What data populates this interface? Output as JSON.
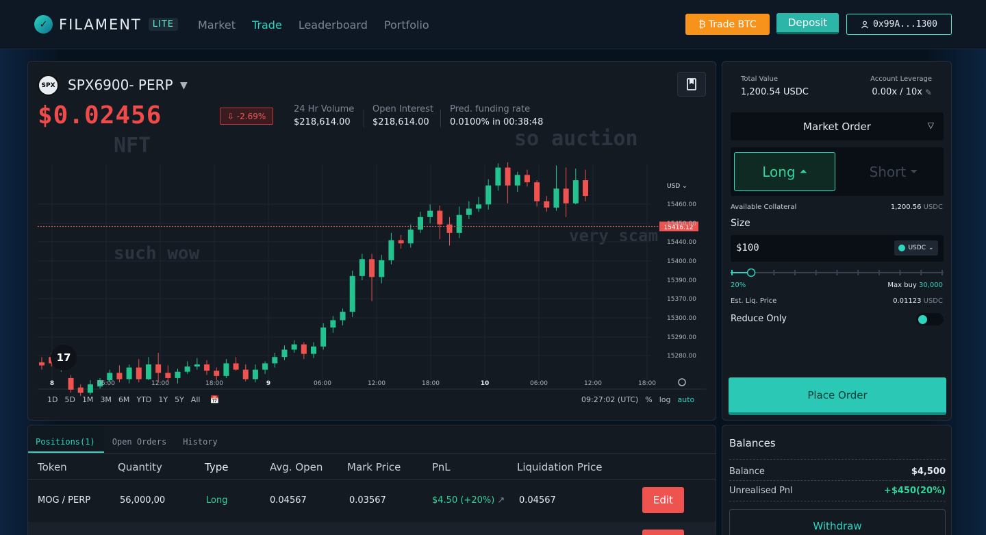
{
  "app": {
    "brand": "FILAMENT",
    "edition": "LITE"
  },
  "nav": [
    {
      "label": "Market",
      "active": false
    },
    {
      "label": "Trade",
      "active": true
    },
    {
      "label": "Leaderboard",
      "active": false
    },
    {
      "label": "Portfolio",
      "active": false
    }
  ],
  "header": {
    "trade_btc": "Trade BTC",
    "deposit": "Deposit",
    "wallet": "0x99A...1300"
  },
  "market": {
    "name": "SPX6900- PERP",
    "price": "$0.02456",
    "change": "-2.69%",
    "stats": [
      {
        "label": "24 Hr Volume",
        "value": "$218,614.00"
      },
      {
        "label": "Open Interest",
        "value": "$218,614.00"
      },
      {
        "label": "Pred. funding rate",
        "value": "0.0100% in 00:38:48"
      }
    ],
    "watermarks": [
      "NFT",
      "so auction",
      "such wow",
      "very scam"
    ]
  },
  "chart_data": {
    "type": "candlestick",
    "currency": "USD",
    "ylim": [
      15270,
      15475
    ],
    "y_ticks": [
      "15460.00",
      "15450.00",
      "15440.00",
      "15400.00",
      "15390.00",
      "15370.00",
      "15300.00",
      "15290.00",
      "15280.00"
    ],
    "x_ticks": [
      "8",
      "06:00",
      "12:00",
      "18:00",
      "9",
      "06:00",
      "12:00",
      "18:00",
      "10",
      "06:00",
      "12:00",
      "18:00"
    ],
    "last_price": "15416.12",
    "candles": [
      [
        15287,
        15284,
        15292,
        15280
      ],
      [
        15292,
        15286,
        15296,
        15283
      ],
      [
        15280,
        15287,
        15290,
        15278
      ],
      [
        15272,
        15261,
        15275,
        15258
      ],
      [
        15263,
        15258,
        15266,
        15255
      ],
      [
        15258,
        15266,
        15270,
        15256
      ],
      [
        15264,
        15270,
        15272,
        15262
      ],
      [
        15270,
        15277,
        15280,
        15268
      ],
      [
        15277,
        15271,
        15284,
        15268
      ],
      [
        15271,
        15282,
        15285,
        15267
      ],
      [
        15282,
        15271,
        15290,
        15268
      ],
      [
        15271,
        15285,
        15292,
        15270
      ],
      [
        15285,
        15277,
        15296,
        15268
      ],
      [
        15277,
        15272,
        15284,
        15268
      ],
      [
        15272,
        15278,
        15281,
        15267
      ],
      [
        15278,
        15283,
        15288,
        15276
      ],
      [
        15283,
        15285,
        15291,
        15280
      ],
      [
        15285,
        15279,
        15289,
        15275
      ],
      [
        15279,
        15274,
        15282,
        15270
      ],
      [
        15274,
        15286,
        15290,
        15272
      ],
      [
        15286,
        15280,
        15292,
        15279
      ],
      [
        15280,
        15271,
        15285,
        15269
      ],
      [
        15271,
        15280,
        15285,
        15268
      ],
      [
        15280,
        15286,
        15288,
        15276
      ],
      [
        15286,
        15292,
        15296,
        15282
      ],
      [
        15292,
        15299,
        15303,
        15289
      ],
      [
        15299,
        15304,
        15308,
        15296
      ],
      [
        15304,
        15295,
        15306,
        15290
      ],
      [
        15295,
        15302,
        15306,
        15291
      ],
      [
        15302,
        15320,
        15324,
        15299
      ],
      [
        15320,
        15327,
        15331,
        15315
      ],
      [
        15327,
        15335,
        15338,
        15322
      ],
      [
        15335,
        15369,
        15374,
        15330
      ],
      [
        15369,
        15385,
        15390,
        15365
      ],
      [
        15385,
        15368,
        15390,
        15345
      ],
      [
        15368,
        15384,
        15389,
        15362
      ],
      [
        15384,
        15403,
        15410,
        15380
      ],
      [
        15403,
        15400,
        15408,
        15395
      ],
      [
        15400,
        15413,
        15418,
        15396
      ],
      [
        15413,
        15425,
        15430,
        15410
      ],
      [
        15425,
        15431,
        15437,
        15419
      ],
      [
        15431,
        15418,
        15436,
        15404
      ],
      [
        15418,
        15410,
        15425,
        15398
      ],
      [
        15410,
        15427,
        15435,
        15405
      ],
      [
        15427,
        15433,
        15440,
        15423
      ],
      [
        15433,
        15437,
        15444,
        15430
      ],
      [
        15437,
        15455,
        15461,
        15432
      ],
      [
        15455,
        15472,
        15476,
        15450
      ],
      [
        15472,
        15455,
        15477,
        15438
      ],
      [
        15455,
        15465,
        15468,
        15449
      ],
      [
        15465,
        15458,
        15470,
        15454
      ],
      [
        15458,
        15440,
        15460,
        15435
      ],
      [
        15440,
        15434,
        15445,
        15430
      ],
      [
        15434,
        15452,
        15474,
        15431
      ],
      [
        15452,
        15438,
        15472,
        15425
      ],
      [
        15438,
        15460,
        15471,
        15437
      ],
      [
        15460,
        15445,
        15470,
        15440
      ]
    ]
  },
  "timeframes": [
    "1D",
    "5D",
    "1M",
    "3M",
    "6M",
    "YTD",
    "1Y",
    "5Y",
    "All"
  ],
  "chart_footer": {
    "time": "09:27:02 (UTC)",
    "pct": "%",
    "log": "log",
    "auto": "auto"
  },
  "order": {
    "total_value_label": "Total Value",
    "total_value": "1,200.54 USDC",
    "leverage_label": "Account Leverage",
    "leverage": "0.00x / 10x",
    "order_type": "Market Order",
    "long": "Long",
    "short": "Short",
    "collateral_label": "Available Collateral",
    "collateral_value": "1,200.56",
    "collateral_unit": "USDC",
    "size_label": "Size",
    "size_value": "$100",
    "size_currency": "USDC",
    "slider_pct": "20%",
    "slider_fraction": 0.2,
    "max_buy_label": "Max buy",
    "max_buy": "30,000",
    "liq_label": "Est. Liq. Price",
    "liq_value": "0.01123",
    "liq_unit": "USDC",
    "reduce_only": "Reduce Only",
    "reduce_only_on": true,
    "place": "Place Order"
  },
  "positions": {
    "tabs": [
      "Positions(1)",
      "Open Orders",
      "History"
    ],
    "headers": [
      "Token",
      "Quantity",
      "Type",
      "Avg. Open",
      "Mark Price",
      "PnL",
      "Liquidation Price"
    ],
    "rows": [
      {
        "token": "MOG / PERP",
        "quantity": "56,000,00",
        "type": "Long",
        "avg_open": "0.04567",
        "mark": "0.03567",
        "pnl": "$4.50 (+20%)",
        "liq": "0.04567",
        "action": "Edit"
      }
    ]
  },
  "balances": {
    "title": "Balances",
    "balance_label": "Balance",
    "balance": "$4,500",
    "unrealised_label": "Unrealised Pnl",
    "unrealised": "+$450(20%)",
    "withdraw": "Withdraw"
  },
  "colors": {
    "accent": "#2dd4bf",
    "up": "#22c38e",
    "down": "#ef5350",
    "btc": "#f7931a"
  }
}
